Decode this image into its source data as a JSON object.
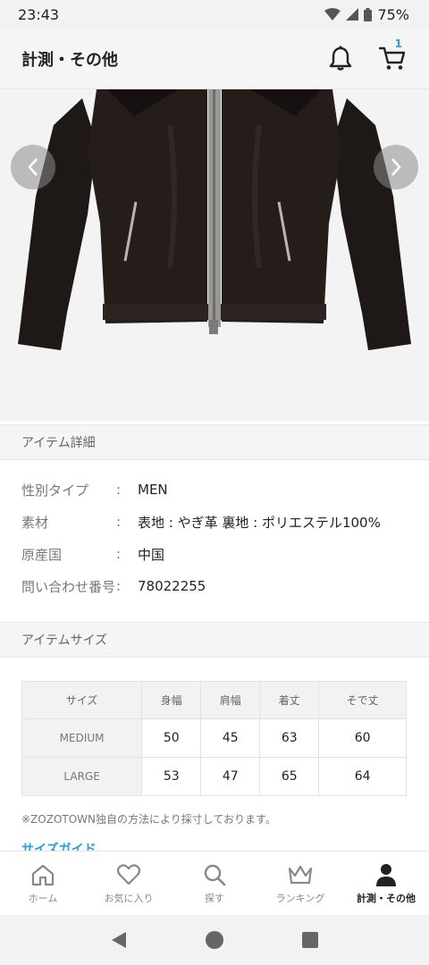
{
  "status": {
    "time": "23:43",
    "battery": "75%"
  },
  "header": {
    "title": "計測・その他",
    "cart_count": "1"
  },
  "details_section": {
    "title": "アイテム詳細",
    "rows": [
      {
        "label": "性別タイプ",
        "colon": ":",
        "value": "MEN"
      },
      {
        "label": "素材",
        "colon": ":",
        "value": "表地 : やぎ革 裏地 : ポリエステル100%"
      },
      {
        "label": "原産国",
        "colon": ":",
        "value": "中国"
      },
      {
        "label": "問い合わせ番号",
        "colon": ":",
        "value": "78022255"
      }
    ]
  },
  "size_section": {
    "title": "アイテムサイズ",
    "columns": [
      "サイズ",
      "身幅",
      "肩幅",
      "着丈",
      "そで丈"
    ],
    "rows": [
      [
        "MEDIUM",
        "50",
        "45",
        "63",
        "60"
      ],
      [
        "LARGE",
        "53",
        "47",
        "65",
        "64"
      ]
    ],
    "note": "※ZOZOTOWN独自の方法により採寸しております。",
    "link": "サイズガイド"
  },
  "bottom_nav": {
    "items": [
      {
        "label": "ホーム",
        "icon": "home-icon"
      },
      {
        "label": "お気に入り",
        "icon": "heart-icon"
      },
      {
        "label": "探す",
        "icon": "search-icon"
      },
      {
        "label": "ランキング",
        "icon": "crown-icon"
      },
      {
        "label": "計測・その他",
        "icon": "person-icon",
        "active": true
      }
    ]
  },
  "colors": {
    "accent": "#2a9fd6",
    "header_bg": "#f5f5f5"
  }
}
